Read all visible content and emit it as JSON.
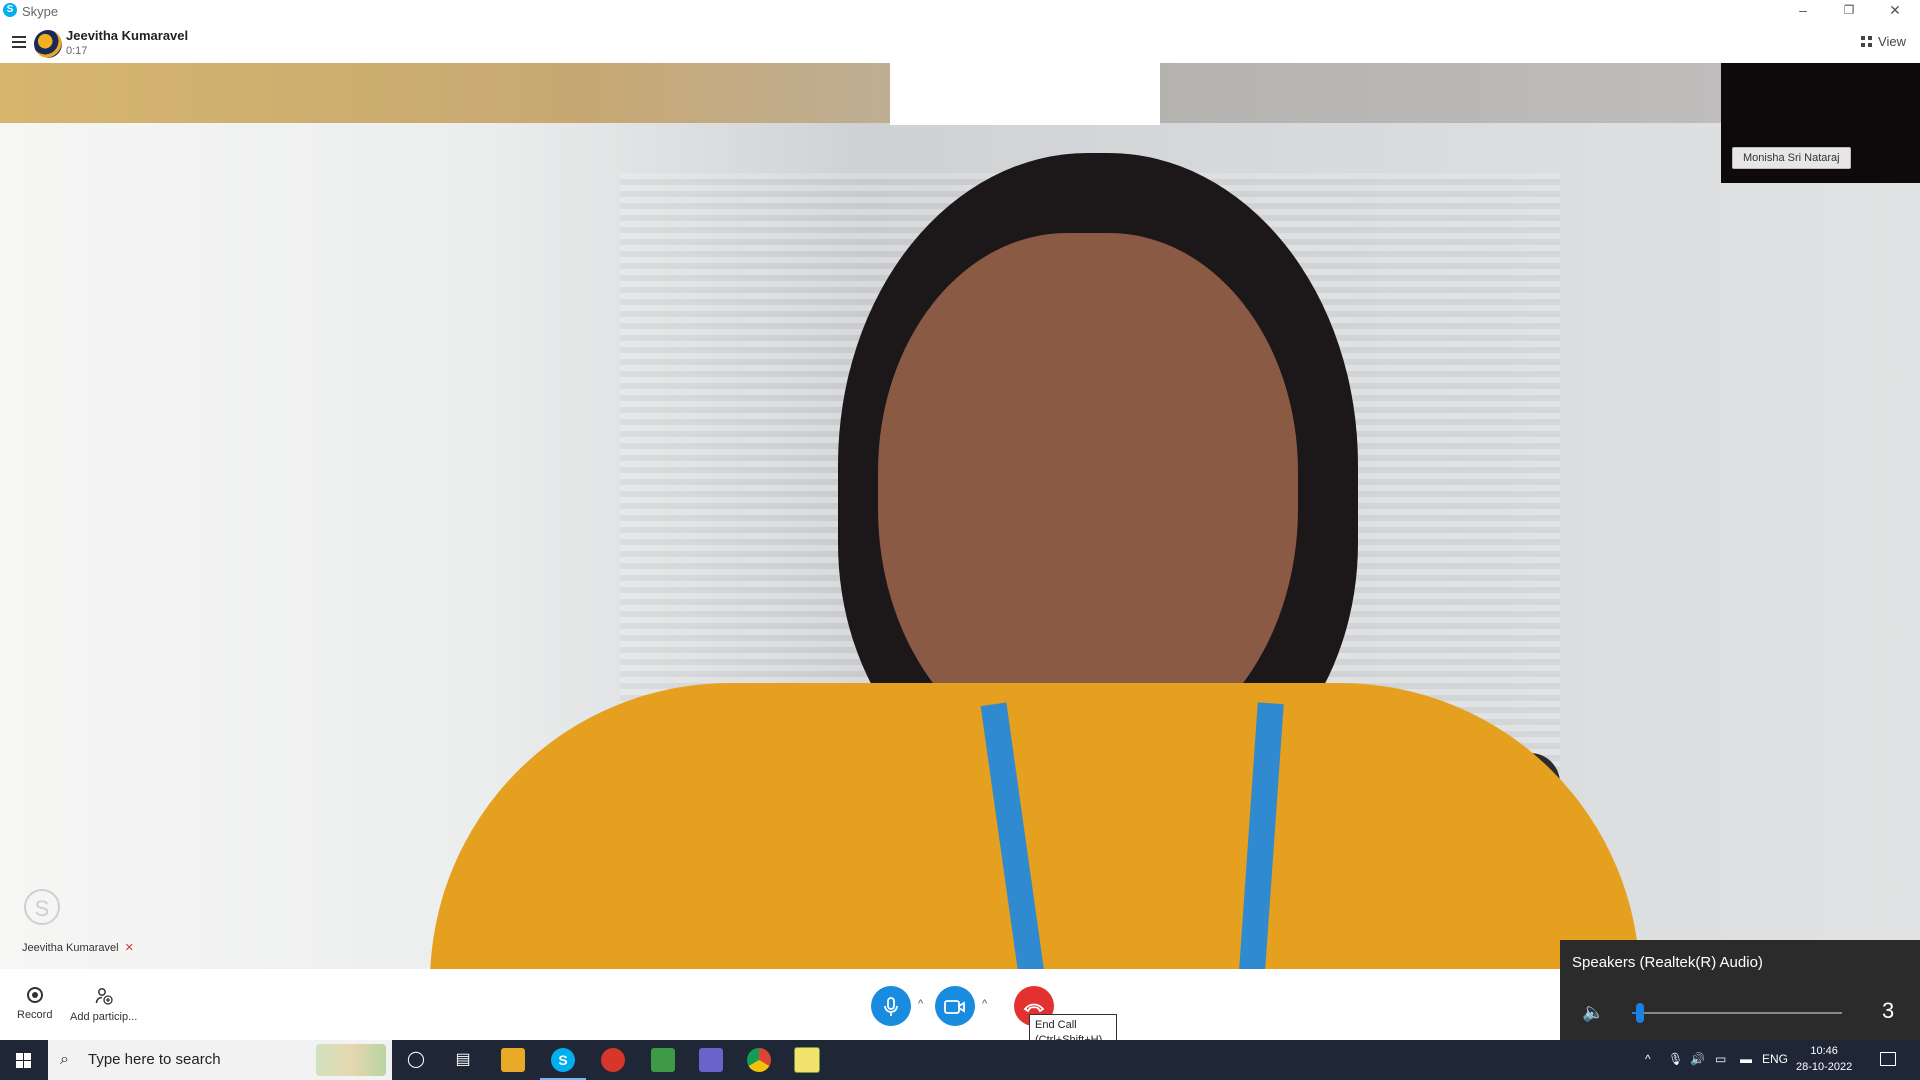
{
  "window": {
    "app_name": "Skype",
    "app_icon_letter": "S",
    "minimize": "–",
    "restore": "❐",
    "close": "✕"
  },
  "call": {
    "caller_name": "Jeevitha Kumaravel",
    "timer": "0:17",
    "view_label": "View"
  },
  "self_preview": {
    "name": "Monisha Sri Nataraj"
  },
  "local_tile": {
    "name": "Jeevitha Kumaravel",
    "logo": "S",
    "mute_glyph": "🎤"
  },
  "controls": {
    "record_label": "Record",
    "add_label": "Add particip...",
    "end_call_tooltip_line1": "End Call",
    "end_call_tooltip_line2": "(Ctrl+Shift+H)"
  },
  "volume_flyout": {
    "device": "Speakers (Realtek(R) Audio)",
    "value": "3",
    "level_percent": 3
  },
  "taskbar": {
    "search_placeholder": "Type here to search",
    "language": "ENG",
    "time": "10:46",
    "date": "28-10-2022"
  },
  "colors": {
    "skype_blue": "#00aff0",
    "call_button_blue": "#1a8ce0",
    "end_call_red": "#e3312f",
    "taskbar_bg": "#1f2636"
  }
}
